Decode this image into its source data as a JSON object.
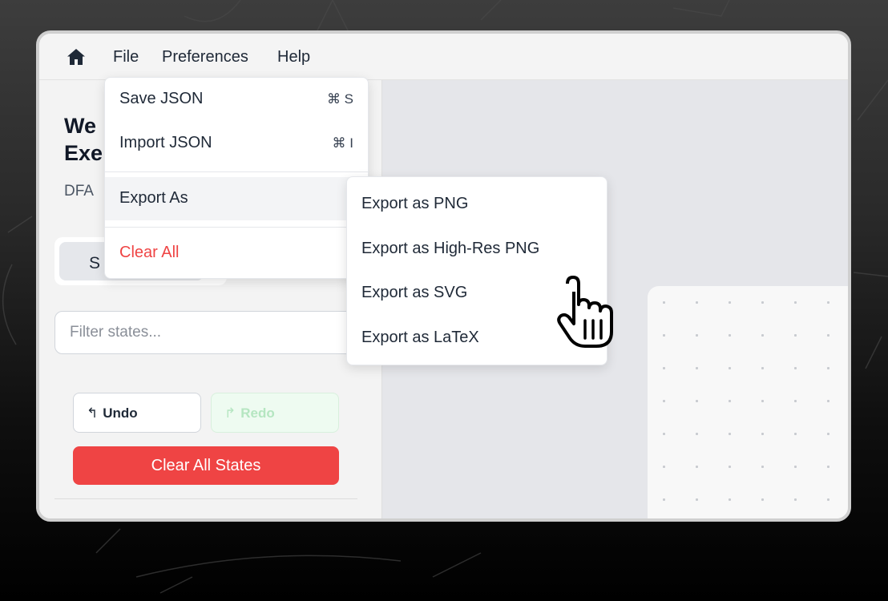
{
  "menubar": {
    "home_icon": "home-icon",
    "file": "File",
    "preferences": "Preferences",
    "help": "Help"
  },
  "file_menu": {
    "save_json": "Save JSON",
    "save_json_shortcut": "⌘ S",
    "import_json": "Import JSON",
    "import_json_shortcut": "⌘ I",
    "export_as": "Export As",
    "clear_all": "Clear All"
  },
  "export_submenu": {
    "items": [
      "Export as PNG",
      "Export as High-Res PNG",
      "Export as SVG",
      "Export as LaTeX"
    ]
  },
  "sidebar": {
    "title_visible": "We\nExe",
    "subtitle_visible": "DFA",
    "tab_active_label": "S",
    "filter_placeholder": "Filter states...",
    "undo_label": "Undo",
    "redo_label": "Redo",
    "clear_all_states": "Clear All States"
  },
  "colors": {
    "danger": "#ef4444",
    "redo_bg": "#eefbf1",
    "redo_text": "#b5e6c1"
  }
}
